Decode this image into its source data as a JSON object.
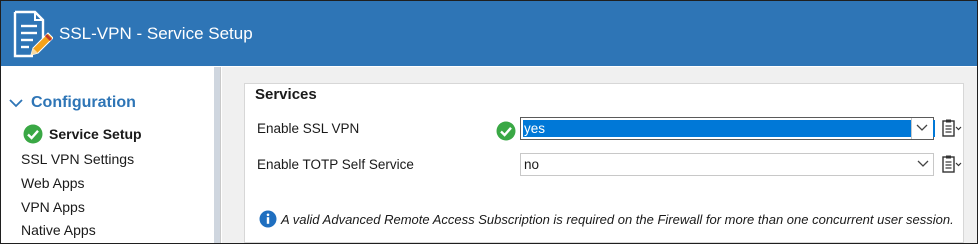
{
  "window": {
    "title": "SSL-VPN - Service Setup",
    "icon": "document-edit-icon",
    "title_bar_color": "#2e75b6"
  },
  "sidebar": {
    "section": "Configuration",
    "items": [
      {
        "label": "Service Setup",
        "active": true,
        "status": "ok"
      },
      {
        "label": "SSL VPN Settings"
      },
      {
        "label": "Web Apps"
      },
      {
        "label": "VPN Apps"
      },
      {
        "label": "Native Apps"
      }
    ],
    "accent_color": "#2e75b6"
  },
  "services": {
    "title": "Services",
    "rows": [
      {
        "label": "Enable SSL VPN",
        "value": "yes",
        "status": "ok"
      },
      {
        "label": "Enable TOTP Self Service",
        "value": "no"
      }
    ],
    "info": "A valid Advanced Remote Access Subscription is required on the Firewall for more than one concurrent user session."
  }
}
